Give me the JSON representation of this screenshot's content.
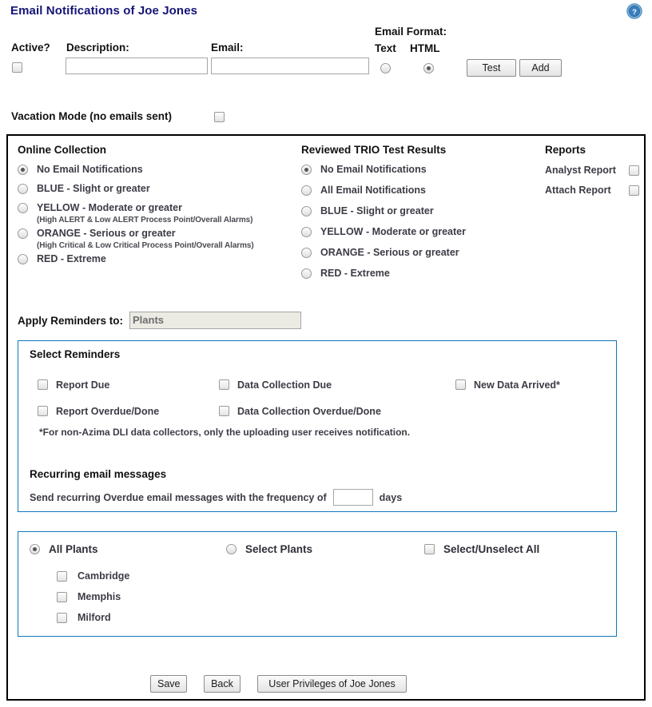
{
  "page": {
    "title": "Email Notifications of Joe Jones",
    "help_icon": "help-question-icon",
    "accent_blue": "#1076b9",
    "title_color": "#141478"
  },
  "account_form": {
    "active_label": "Active?",
    "description_label": "Description:",
    "email_label": "Email:",
    "email_format_label": "Email Format:",
    "text_label": "Text",
    "html_label": "HTML",
    "active_checked": false,
    "description_value": "",
    "description_placeholder": "",
    "email_value": "",
    "email_placeholder": "",
    "format_selected": "HTML",
    "test_button": "Test",
    "add_button": "Add",
    "vacation_label": "Vacation Mode (no emails sent)",
    "vacation_checked": false
  },
  "online_collection": {
    "heading": "Online Collection",
    "selected_index": 0,
    "options": [
      {
        "label": "No Email Notifications",
        "sub": ""
      },
      {
        "label": "BLUE - Slight or greater",
        "sub": ""
      },
      {
        "label": "YELLOW - Moderate or greater",
        "sub": "(High ALERT & Low ALERT Process Point/Overall Alarms)"
      },
      {
        "label": "ORANGE - Serious or greater",
        "sub": "(High Critical & Low Critical Process Point/Overall Alarms)"
      },
      {
        "label": "RED - Extreme",
        "sub": ""
      }
    ]
  },
  "trio_results": {
    "heading": "Reviewed TRIO Test Results",
    "selected_index": 0,
    "options": [
      {
        "label": "No Email Notifications"
      },
      {
        "label": "All Email Notifications"
      },
      {
        "label": "BLUE - Slight or greater"
      },
      {
        "label": "YELLOW - Moderate or greater"
      },
      {
        "label": "ORANGE - Serious or greater"
      },
      {
        "label": "RED - Extreme"
      }
    ]
  },
  "reports": {
    "heading": "Reports",
    "items": [
      {
        "label": "Analyst Report",
        "checked": false
      },
      {
        "label": "Attach Report",
        "checked": false
      }
    ]
  },
  "apply_reminders": {
    "label": "Apply Reminders to:",
    "selected": "Plants"
  },
  "reminders": {
    "heading": "Select Reminders",
    "column1": [
      {
        "label": "Report Due",
        "checked": false
      },
      {
        "label": "Report Overdue/Done",
        "checked": false
      }
    ],
    "column2": [
      {
        "label": "Data Collection Due",
        "checked": false
      },
      {
        "label": "Data Collection Overdue/Done",
        "checked": false
      }
    ],
    "column3": [
      {
        "label": "New Data Arrived*",
        "checked": false
      }
    ],
    "footnote": "*For non-Azima DLI data collectors, only the uploading user receives notification.",
    "recurring_heading": "Recurring email messages",
    "recurring_prefix": "Send recurring Overdue email messages with the frequency of",
    "recurring_value": "",
    "recurring_suffix": "days"
  },
  "plants": {
    "all_plants_label": "All Plants",
    "select_plants_label": "Select Plants",
    "select_unselect_all_label": "Select/Unselect All",
    "mode_selected": "All Plants",
    "select_unselect_all_checked": false,
    "list": [
      {
        "name": "Cambridge",
        "checked": false
      },
      {
        "name": "Memphis",
        "checked": false
      },
      {
        "name": "Milford",
        "checked": false
      }
    ]
  },
  "footer": {
    "save_button": "Save",
    "back_button": "Back",
    "privileges_button": "User Privileges of Joe Jones"
  }
}
